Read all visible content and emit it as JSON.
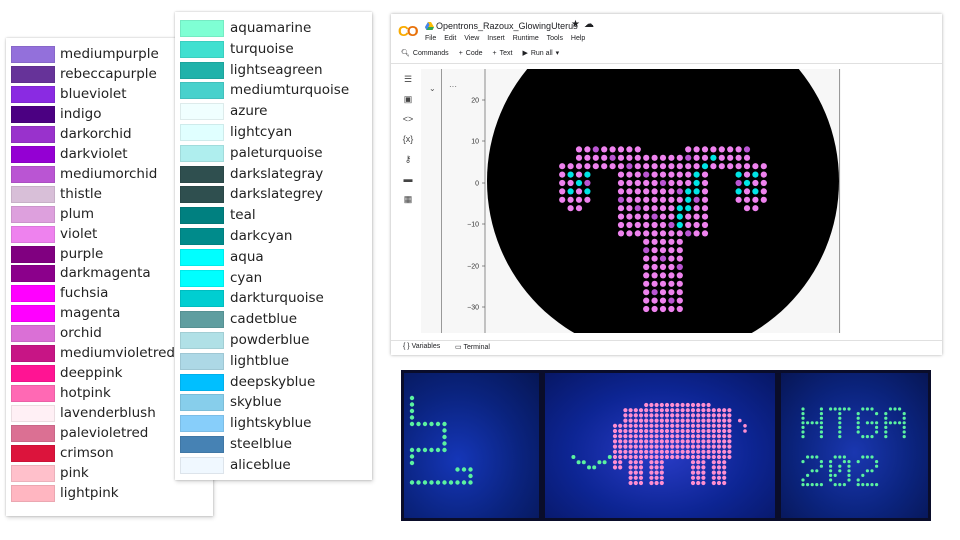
{
  "legend_left": {
    "items": [
      {
        "name": "mediumpurple",
        "color": "#9370db"
      },
      {
        "name": "rebeccapurple",
        "color": "#663399"
      },
      {
        "name": "blueviolet",
        "color": "#8a2be2"
      },
      {
        "name": "indigo",
        "color": "#4b0082"
      },
      {
        "name": "darkorchid",
        "color": "#9932cc"
      },
      {
        "name": "darkviolet",
        "color": "#9400d3"
      },
      {
        "name": "mediumorchid",
        "color": "#ba55d3"
      },
      {
        "name": "thistle",
        "color": "#d8bfd8"
      },
      {
        "name": "plum",
        "color": "#dda0dd"
      },
      {
        "name": "violet",
        "color": "#ee82ee"
      },
      {
        "name": "purple",
        "color": "#800080"
      },
      {
        "name": "darkmagenta",
        "color": "#8b008b"
      },
      {
        "name": "fuchsia",
        "color": "#ff00ff"
      },
      {
        "name": "magenta",
        "color": "#ff00ff"
      },
      {
        "name": "orchid",
        "color": "#da70d6"
      },
      {
        "name": "mediumvioletred",
        "color": "#c71585"
      },
      {
        "name": "deeppink",
        "color": "#ff1493"
      },
      {
        "name": "hotpink",
        "color": "#ff69b4"
      },
      {
        "name": "lavenderblush",
        "color": "#fff0f5"
      },
      {
        "name": "palevioletred",
        "color": "#db7093"
      },
      {
        "name": "crimson",
        "color": "#dc143c"
      },
      {
        "name": "pink",
        "color": "#ffc0cb"
      },
      {
        "name": "lightpink",
        "color": "#ffb6c1"
      }
    ]
  },
  "legend_right": {
    "items": [
      {
        "name": "aquamarine",
        "color": "#7fffd4"
      },
      {
        "name": "turquoise",
        "color": "#40e0d0"
      },
      {
        "name": "lightseagreen",
        "color": "#20b2aa"
      },
      {
        "name": "mediumturquoise",
        "color": "#48d1cc"
      },
      {
        "name": "azure",
        "color": "#f0ffff"
      },
      {
        "name": "lightcyan",
        "color": "#e0ffff"
      },
      {
        "name": "paleturquoise",
        "color": "#afeeee"
      },
      {
        "name": "darkslategray",
        "color": "#2f4f4f"
      },
      {
        "name": "darkslategrey",
        "color": "#2f4f4f"
      },
      {
        "name": "teal",
        "color": "#008080"
      },
      {
        "name": "darkcyan",
        "color": "#008b8b"
      },
      {
        "name": "aqua",
        "color": "#00ffff"
      },
      {
        "name": "cyan",
        "color": "#00ffff"
      },
      {
        "name": "darkturquoise",
        "color": "#00ced1"
      },
      {
        "name": "cadetblue",
        "color": "#5f9ea0"
      },
      {
        "name": "powderblue",
        "color": "#b0e0e6"
      },
      {
        "name": "lightblue",
        "color": "#add8e6"
      },
      {
        "name": "deepskyblue",
        "color": "#00bfff"
      },
      {
        "name": "skyblue",
        "color": "#87ceeb"
      },
      {
        "name": "lightskyblue",
        "color": "#87cefa"
      },
      {
        "name": "steelblue",
        "color": "#4682b4"
      },
      {
        "name": "aliceblue",
        "color": "#f0f8ff"
      }
    ]
  },
  "colab": {
    "notebook_title": "Opentrons_Razoux_GlowingUterus",
    "menu": [
      "File",
      "Edit",
      "View",
      "Insert",
      "Runtime",
      "Tools",
      "Help"
    ],
    "toolbar": {
      "commands": "Commands",
      "code": "Code",
      "text": "Text",
      "run_all": "Run all"
    },
    "sidebar_icons": [
      "toc-icon",
      "find-icon",
      "code-snippets-icon",
      "variable-inspector-icon",
      "key-icon",
      "folder-icon",
      "table-icon"
    ],
    "cell_more": "···",
    "plot": {
      "ytick_labels": [
        "20",
        "10",
        "0",
        "−10",
        "−20",
        "−30"
      ],
      "background_color": "#000000",
      "dot_color_pink": "#ee82ee",
      "dot_color_purple": "#ba55d3",
      "dot_color_cyan": "#00e5e5"
    },
    "status": {
      "variables": "Variables",
      "terminal": "Terminal"
    }
  },
  "photo_panels": {
    "panel_2_subject": "pixel-elephant",
    "panel_3_text": [
      "HTGA",
      "2 0 2"
    ]
  },
  "colors": {
    "colab_orange": "#f9ab00",
    "photo_blue": "#0d2594",
    "led_green": "#5bf2a0",
    "led_pink": "#ff8fd0"
  }
}
